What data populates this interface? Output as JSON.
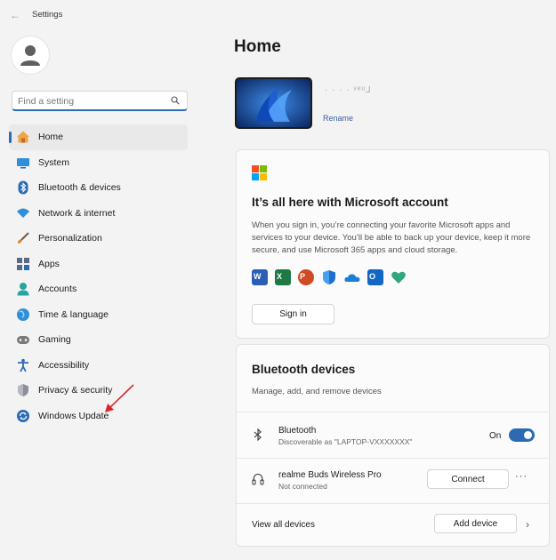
{
  "window": {
    "title": "Settings",
    "back_icon": "back-arrow-icon"
  },
  "sidebar": {
    "search_placeholder": "Find a setting",
    "items": [
      {
        "label": "Home",
        "icon": "home-icon",
        "active": true
      },
      {
        "label": "System",
        "icon": "system-icon"
      },
      {
        "label": "Bluetooth & devices",
        "icon": "bluetooth-icon"
      },
      {
        "label": "Network & internet",
        "icon": "wifi-icon"
      },
      {
        "label": "Personalization",
        "icon": "brush-icon"
      },
      {
        "label": "Apps",
        "icon": "apps-icon"
      },
      {
        "label": "Accounts",
        "icon": "accounts-icon"
      },
      {
        "label": "Time & language",
        "icon": "globe-icon"
      },
      {
        "label": "Gaming",
        "icon": "gamepad-icon"
      },
      {
        "label": "Accessibility",
        "icon": "accessibility-icon"
      },
      {
        "label": "Privacy & security",
        "icon": "shield-icon"
      },
      {
        "label": "Windows Update",
        "icon": "update-icon"
      }
    ]
  },
  "main": {
    "title": "Home",
    "device": {
      "name": "·  ·  ·  ·   ᵛᵉᵘ⅃",
      "rename_label": "Rename"
    },
    "ms_account": {
      "heading": "It’s all here with Microsoft account",
      "body": "When you sign in, you’re connecting your favorite Microsoft apps and services to your device. You’ll be able to back up your device, keep it more secure, and use Microsoft 365 apps and cloud storage.",
      "sign_in_label": "Sign in",
      "apps": [
        "word-icon",
        "excel-icon",
        "powerpoint-icon",
        "defender-icon",
        "onedrive-icon",
        "outlook-icon",
        "family-icon"
      ]
    },
    "bluetooth": {
      "title": "Bluetooth devices",
      "subtitle": "Manage, add, and remove devices",
      "bt_row": {
        "title": "Bluetooth",
        "subtitle": "Discoverable as \"LAPTOP-VXXXXXXX\"",
        "state_label": "On",
        "on": true
      },
      "device_row": {
        "title": "realme Buds Wireless Pro",
        "subtitle": "Not connected",
        "connect_label": "Connect",
        "more_label": "···"
      },
      "view_all_label": "View all devices",
      "add_device_label": "Add device",
      "chevron": "›"
    }
  },
  "colors": {
    "accent": "#2c6bb4",
    "annotation_arrow": "#d9252a"
  }
}
